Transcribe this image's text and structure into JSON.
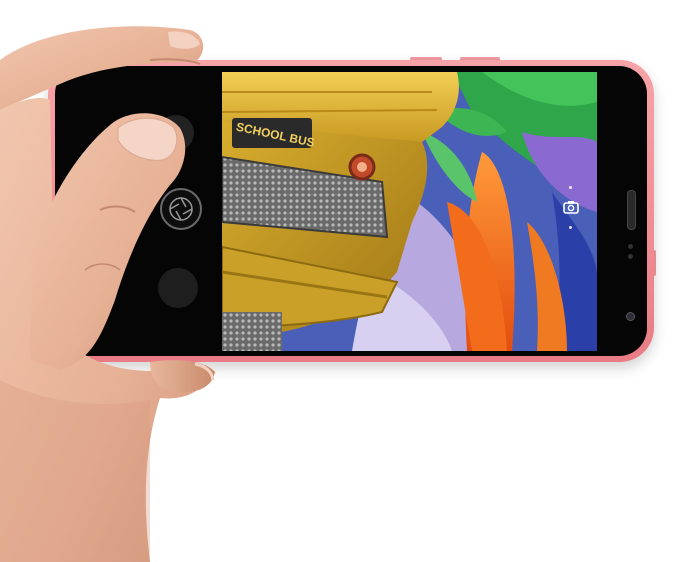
{
  "screen": {
    "bus_sign_text": "SCHOOL BUS"
  },
  "colors": {
    "phone_body": "#f08e95",
    "bezel": "#050505",
    "skin": "#e9b79c",
    "bus_yellow": "#e0b838",
    "feather_orange": "#f06a1a",
    "feather_green": "#3fb44a",
    "feather_blue": "#2a4fd0"
  },
  "icons": {
    "mode": "circle-outline-icon",
    "shutter": "aperture-icon",
    "gallery": "gallery-thumbnail-icon",
    "effect": "filter-icon",
    "switch_camera": "camera-switch-icon"
  }
}
